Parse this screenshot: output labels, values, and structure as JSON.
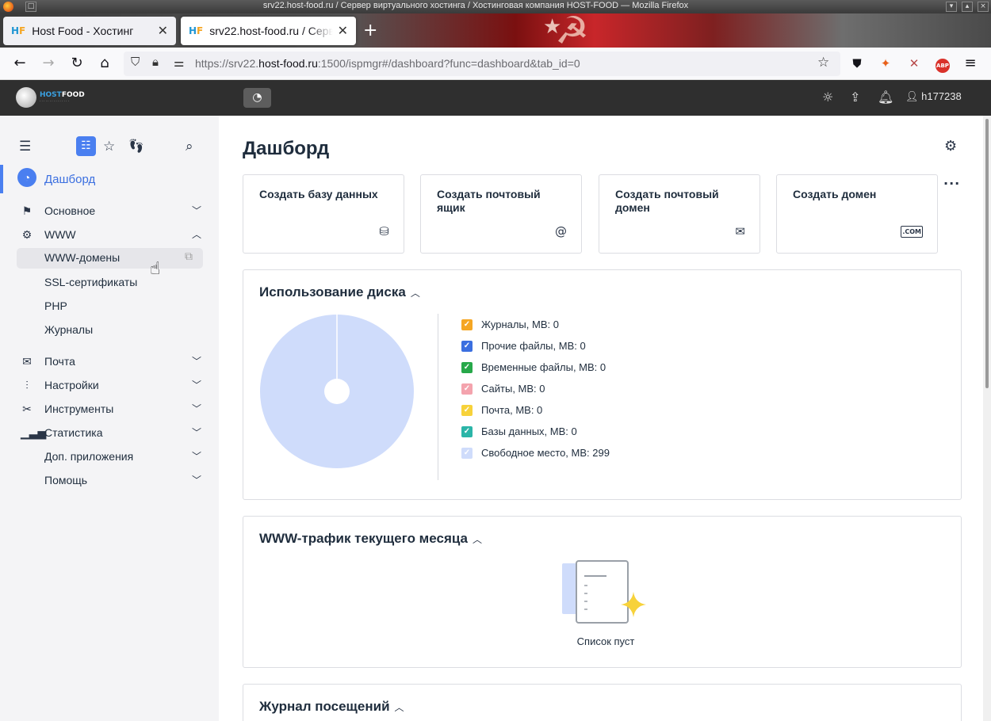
{
  "window": {
    "title": "srv22.host-food.ru / Сервер виртуального хостинга / Хостинговая компания HOST-FOOD — Mozilla Firefox"
  },
  "browser": {
    "tabs": [
      {
        "label": "Host Food - Хостинг",
        "favicon": "HF"
      },
      {
        "label": "srv22.host-food.ru / Серве",
        "favicon": "HF"
      }
    ],
    "url_prefix": "https://srv22.",
    "url_domain": "host-food.ru",
    "url_suffix": ":1500/ispmgr#/dashboard?func=dashboard&tab_id=0"
  },
  "header": {
    "logo_h": "HOST",
    "logo_f": "FOOD",
    "username": "h177238"
  },
  "sidebar": {
    "items": [
      {
        "label": "Дашборд",
        "icon": "dashboard-icon"
      },
      {
        "label": "Основное",
        "icon": "flag-icon"
      },
      {
        "label": "WWW",
        "icon": "www-icon"
      },
      {
        "label": "WWW-домены"
      },
      {
        "label": "SSL-сертификаты"
      },
      {
        "label": "PHP"
      },
      {
        "label": "Журналы"
      },
      {
        "label": "Почта",
        "icon": "mail-icon"
      },
      {
        "label": "Настройки",
        "icon": "sliders-icon"
      },
      {
        "label": "Инструменты",
        "icon": "tools-icon"
      },
      {
        "label": "Статистика",
        "icon": "stats-icon"
      },
      {
        "label": "Доп. приложения"
      },
      {
        "label": "Помощь"
      }
    ]
  },
  "main": {
    "title": "Дашборд",
    "quick_actions": [
      {
        "line1": "Создать базу данных",
        "line2": "",
        "icon": "database-icon"
      },
      {
        "line1": "Создать почтовый",
        "line2": "ящик",
        "icon": "at-icon"
      },
      {
        "line1": "Создать почтовый",
        "line2": "домен",
        "icon": "envelope-icon"
      },
      {
        "line1": "Создать домен",
        "line2": "",
        "icon": "com-domain-icon"
      }
    ],
    "disk_panel": {
      "title": "Использование диска",
      "legend": [
        {
          "label": "Журналы, MB: 0",
          "color": "#f5a623"
        },
        {
          "label": "Прочие файлы, MB: 0",
          "color": "#3b6fe0"
        },
        {
          "label": "Временные файлы, MB: 0",
          "color": "#27a84a"
        },
        {
          "label": "Сайты, MB: 0",
          "color": "#f4a3ad"
        },
        {
          "label": "Почта, MB: 0",
          "color": "#f7d23a"
        },
        {
          "label": "Базы данных, MB: 0",
          "color": "#2bb5a8"
        },
        {
          "label": "Свободное место, MB: 299",
          "color": "#cfdcfb"
        }
      ]
    },
    "traffic_panel": {
      "title": "WWW-трафик текущего месяца",
      "empty_text": "Список пуст"
    },
    "visits_panel": {
      "title": "Журнал посещений"
    }
  },
  "chart_data": {
    "type": "pie",
    "title": "Использование диска",
    "categories": [
      "Журналы",
      "Прочие файлы",
      "Временные файлы",
      "Сайты",
      "Почта",
      "Базы данных",
      "Свободное место"
    ],
    "values": [
      0,
      0,
      0,
      0,
      0,
      0,
      299
    ],
    "unit": "MB"
  }
}
